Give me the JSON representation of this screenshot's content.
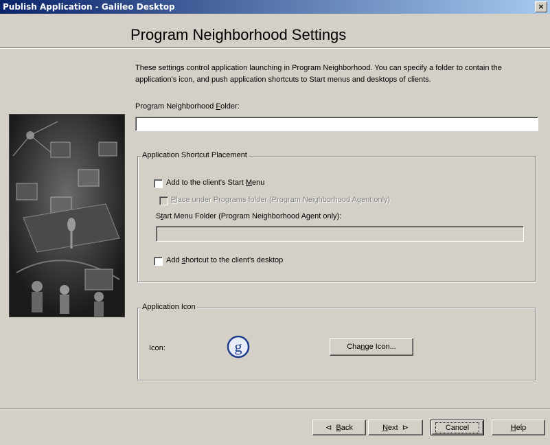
{
  "window": {
    "title": "Publish Application - Galileo Desktop",
    "close_glyph": "×"
  },
  "page": {
    "heading": "Program Neighborhood Settings",
    "description": "These settings control application launching in Program Neighborhood.  You can specify a folder to contain the application's icon, and push application shortcuts to Start menus and desktops of clients."
  },
  "folder": {
    "label_pre": "Program Neighborhood ",
    "label_key": "F",
    "label_post": "older:",
    "value": ""
  },
  "shortcut_group": {
    "legend": "Application Shortcut Placement",
    "start_menu": {
      "pre": "Add to the client's Start ",
      "key": "M",
      "post": "enu",
      "checked": false
    },
    "programs_folder": {
      "pre": "",
      "key": "P",
      "post": "lace under Programs folder (Program Neighborhood Agent only)",
      "checked": false,
      "enabled": false
    },
    "start_menu_folder": {
      "pre": "S",
      "key": "t",
      "post": "art Menu Folder (Program Neighborhood Agent only):",
      "value": ""
    },
    "desktop": {
      "pre": "Add ",
      "key": "s",
      "post": "hortcut to the client's desktop",
      "checked": false
    }
  },
  "icon_group": {
    "legend": "Application Icon",
    "icon_label": "Icon:",
    "icon_glyph": "g",
    "change_pre": "Cha",
    "change_key": "n",
    "change_post": "ge Icon..."
  },
  "buttons": {
    "back_arrow": "⊲",
    "back_key": "B",
    "back_post": "ack",
    "next_pre": "",
    "next_key": "N",
    "next_post": "ext",
    "next_arrow": "⊳",
    "cancel": "Cancel",
    "help_key": "H",
    "help_post": "elp"
  },
  "colors": {
    "face": "#d4d0c8",
    "titlebar_start": "#0a246a",
    "titlebar_end": "#a6caf0",
    "icon_blue": "#1c3b8a"
  }
}
